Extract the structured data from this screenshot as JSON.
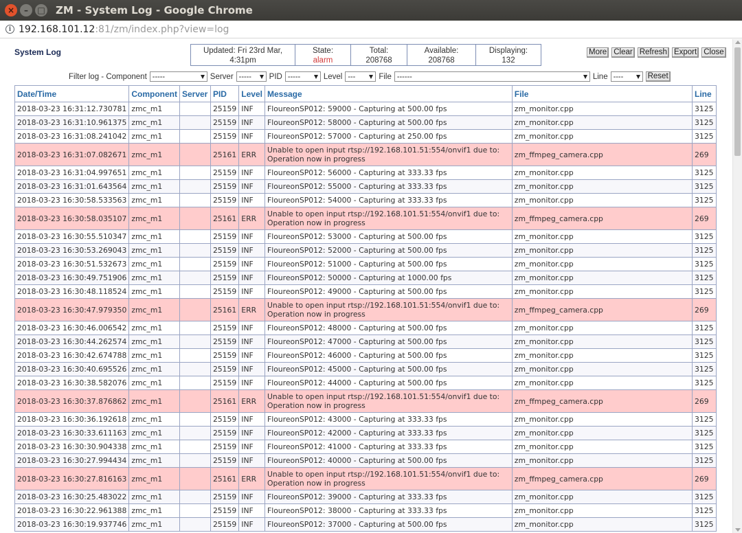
{
  "window": {
    "title": "ZM - System Log - Google Chrome"
  },
  "address": {
    "host": "192.168.101.12",
    "rest": ":81/zm/index.php?view=log"
  },
  "page": {
    "title": "System Log"
  },
  "status": {
    "updated_label": "Updated: Fri 23rd Mar,",
    "updated_time": "4:31pm",
    "state_label": "State:",
    "state_value": "alarm",
    "total_label": "Total:",
    "total_value": "208768",
    "available_label": "Available:",
    "available_value": "208768",
    "displaying_label": "Displaying:",
    "displaying_value": "132"
  },
  "actions": {
    "more": "More",
    "clear": "Clear",
    "refresh": "Refresh",
    "export": "Export",
    "close": "Close"
  },
  "filter": {
    "label": "Filter log - Component",
    "component_value": "-----",
    "server_label": "Server",
    "server_value": "-----",
    "pid_label": "PID",
    "pid_value": "-----",
    "level_label": "Level",
    "level_value": "---",
    "file_label": "File",
    "file_value": "------",
    "line_label": "Line",
    "line_value": "----",
    "reset": "Reset"
  },
  "table": {
    "headers": [
      "Date/Time",
      "Component",
      "Server",
      "PID",
      "Level",
      "Message",
      "File",
      "Line"
    ],
    "rows": [
      {
        "dt": "2018-03-23 16:31:12.730781",
        "comp": "zmc_m1",
        "server": "",
        "pid": "25159",
        "level": "INF",
        "msg": "FloureonSP012: 59000 - Capturing at 500.00 fps",
        "file": "zm_monitor.cpp",
        "line": "3125"
      },
      {
        "dt": "2018-03-23 16:31:10.961375",
        "comp": "zmc_m1",
        "server": "",
        "pid": "25159",
        "level": "INF",
        "msg": "FloureonSP012: 58000 - Capturing at 500.00 fps",
        "file": "zm_monitor.cpp",
        "line": "3125"
      },
      {
        "dt": "2018-03-23 16:31:08.241042",
        "comp": "zmc_m1",
        "server": "",
        "pid": "25159",
        "level": "INF",
        "msg": "FloureonSP012: 57000 - Capturing at 250.00 fps",
        "file": "zm_monitor.cpp",
        "line": "3125"
      },
      {
        "dt": "2018-03-23 16:31:07.082671",
        "comp": "zmc_m1",
        "server": "",
        "pid": "25161",
        "level": "ERR",
        "msg": "Unable to open input rtsp://192.168.101.51:554/onvif1 due to: Operation now in progress",
        "file": "zm_ffmpeg_camera.cpp",
        "line": "269"
      },
      {
        "dt": "2018-03-23 16:31:04.997651",
        "comp": "zmc_m1",
        "server": "",
        "pid": "25159",
        "level": "INF",
        "msg": "FloureonSP012: 56000 - Capturing at 333.33 fps",
        "file": "zm_monitor.cpp",
        "line": "3125"
      },
      {
        "dt": "2018-03-23 16:31:01.643564",
        "comp": "zmc_m1",
        "server": "",
        "pid": "25159",
        "level": "INF",
        "msg": "FloureonSP012: 55000 - Capturing at 333.33 fps",
        "file": "zm_monitor.cpp",
        "line": "3125"
      },
      {
        "dt": "2018-03-23 16:30:58.533563",
        "comp": "zmc_m1",
        "server": "",
        "pid": "25159",
        "level": "INF",
        "msg": "FloureonSP012: 54000 - Capturing at 333.33 fps",
        "file": "zm_monitor.cpp",
        "line": "3125"
      },
      {
        "dt": "2018-03-23 16:30:58.035107",
        "comp": "zmc_m1",
        "server": "",
        "pid": "25161",
        "level": "ERR",
        "msg": "Unable to open input rtsp://192.168.101.51:554/onvif1 due to: Operation now in progress",
        "file": "zm_ffmpeg_camera.cpp",
        "line": "269"
      },
      {
        "dt": "2018-03-23 16:30:55.510347",
        "comp": "zmc_m1",
        "server": "",
        "pid": "25159",
        "level": "INF",
        "msg": "FloureonSP012: 53000 - Capturing at 500.00 fps",
        "file": "zm_monitor.cpp",
        "line": "3125"
      },
      {
        "dt": "2018-03-23 16:30:53.269043",
        "comp": "zmc_m1",
        "server": "",
        "pid": "25159",
        "level": "INF",
        "msg": "FloureonSP012: 52000 - Capturing at 500.00 fps",
        "file": "zm_monitor.cpp",
        "line": "3125"
      },
      {
        "dt": "2018-03-23 16:30:51.532673",
        "comp": "zmc_m1",
        "server": "",
        "pid": "25159",
        "level": "INF",
        "msg": "FloureonSP012: 51000 - Capturing at 500.00 fps",
        "file": "zm_monitor.cpp",
        "line": "3125"
      },
      {
        "dt": "2018-03-23 16:30:49.751906",
        "comp": "zmc_m1",
        "server": "",
        "pid": "25159",
        "level": "INF",
        "msg": "FloureonSP012: 50000 - Capturing at 1000.00 fps",
        "file": "zm_monitor.cpp",
        "line": "3125"
      },
      {
        "dt": "2018-03-23 16:30:48.118524",
        "comp": "zmc_m1",
        "server": "",
        "pid": "25159",
        "level": "INF",
        "msg": "FloureonSP012: 49000 - Capturing at 500.00 fps",
        "file": "zm_monitor.cpp",
        "line": "3125"
      },
      {
        "dt": "2018-03-23 16:30:47.979350",
        "comp": "zmc_m1",
        "server": "",
        "pid": "25161",
        "level": "ERR",
        "msg": "Unable to open input rtsp://192.168.101.51:554/onvif1 due to: Operation now in progress",
        "file": "zm_ffmpeg_camera.cpp",
        "line": "269"
      },
      {
        "dt": "2018-03-23 16:30:46.006542",
        "comp": "zmc_m1",
        "server": "",
        "pid": "25159",
        "level": "INF",
        "msg": "FloureonSP012: 48000 - Capturing at 500.00 fps",
        "file": "zm_monitor.cpp",
        "line": "3125"
      },
      {
        "dt": "2018-03-23 16:30:44.262574",
        "comp": "zmc_m1",
        "server": "",
        "pid": "25159",
        "level": "INF",
        "msg": "FloureonSP012: 47000 - Capturing at 500.00 fps",
        "file": "zm_monitor.cpp",
        "line": "3125"
      },
      {
        "dt": "2018-03-23 16:30:42.674788",
        "comp": "zmc_m1",
        "server": "",
        "pid": "25159",
        "level": "INF",
        "msg": "FloureonSP012: 46000 - Capturing at 500.00 fps",
        "file": "zm_monitor.cpp",
        "line": "3125"
      },
      {
        "dt": "2018-03-23 16:30:40.695526",
        "comp": "zmc_m1",
        "server": "",
        "pid": "25159",
        "level": "INF",
        "msg": "FloureonSP012: 45000 - Capturing at 500.00 fps",
        "file": "zm_monitor.cpp",
        "line": "3125"
      },
      {
        "dt": "2018-03-23 16:30:38.582076",
        "comp": "zmc_m1",
        "server": "",
        "pid": "25159",
        "level": "INF",
        "msg": "FloureonSP012: 44000 - Capturing at 500.00 fps",
        "file": "zm_monitor.cpp",
        "line": "3125"
      },
      {
        "dt": "2018-03-23 16:30:37.876862",
        "comp": "zmc_m1",
        "server": "",
        "pid": "25161",
        "level": "ERR",
        "msg": "Unable to open input rtsp://192.168.101.51:554/onvif1 due to: Operation now in progress",
        "file": "zm_ffmpeg_camera.cpp",
        "line": "269"
      },
      {
        "dt": "2018-03-23 16:30:36.192618",
        "comp": "zmc_m1",
        "server": "",
        "pid": "25159",
        "level": "INF",
        "msg": "FloureonSP012: 43000 - Capturing at 333.33 fps",
        "file": "zm_monitor.cpp",
        "line": "3125"
      },
      {
        "dt": "2018-03-23 16:30:33.611163",
        "comp": "zmc_m1",
        "server": "",
        "pid": "25159",
        "level": "INF",
        "msg": "FloureonSP012: 42000 - Capturing at 333.33 fps",
        "file": "zm_monitor.cpp",
        "line": "3125"
      },
      {
        "dt": "2018-03-23 16:30:30.904338",
        "comp": "zmc_m1",
        "server": "",
        "pid": "25159",
        "level": "INF",
        "msg": "FloureonSP012: 41000 - Capturing at 333.33 fps",
        "file": "zm_monitor.cpp",
        "line": "3125"
      },
      {
        "dt": "2018-03-23 16:30:27.994434",
        "comp": "zmc_m1",
        "server": "",
        "pid": "25159",
        "level": "INF",
        "msg": "FloureonSP012: 40000 - Capturing at 500.00 fps",
        "file": "zm_monitor.cpp",
        "line": "3125"
      },
      {
        "dt": "2018-03-23 16:30:27.816163",
        "comp": "zmc_m1",
        "server": "",
        "pid": "25161",
        "level": "ERR",
        "msg": "Unable to open input rtsp://192.168.101.51:554/onvif1 due to: Operation now in progress",
        "file": "zm_ffmpeg_camera.cpp",
        "line": "269"
      },
      {
        "dt": "2018-03-23 16:30:25.483022",
        "comp": "zmc_m1",
        "server": "",
        "pid": "25159",
        "level": "INF",
        "msg": "FloureonSP012: 39000 - Capturing at 333.33 fps",
        "file": "zm_monitor.cpp",
        "line": "3125"
      },
      {
        "dt": "2018-03-23 16:30:22.961388",
        "comp": "zmc_m1",
        "server": "",
        "pid": "25159",
        "level": "INF",
        "msg": "FloureonSP012: 38000 - Capturing at 333.33 fps",
        "file": "zm_monitor.cpp",
        "line": "3125"
      },
      {
        "dt": "2018-03-23 16:30:19.937746",
        "comp": "zmc_m1",
        "server": "",
        "pid": "25159",
        "level": "INF",
        "msg": "FloureonSP012: 37000 - Capturing at 500.00 fps",
        "file": "zm_monitor.cpp",
        "line": "3125"
      }
    ]
  },
  "colors": {
    "error_row": "#ffcccc",
    "header_text": "#2a6aa5",
    "alarm": "#d23a3a",
    "title": "#1a2a55"
  }
}
